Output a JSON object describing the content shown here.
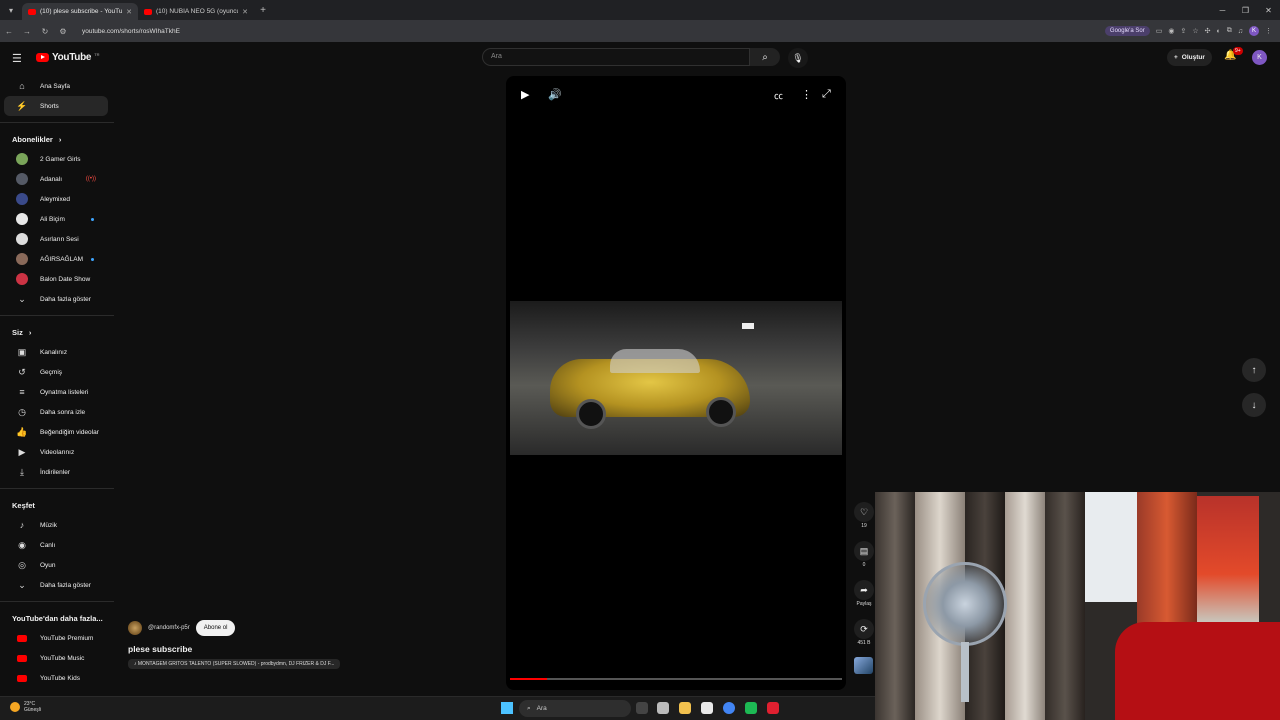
{
  "browser": {
    "tabs": [
      {
        "title": "(10) plese subscribe - YouTube",
        "active": true
      },
      {
        "title": "(10) NUBIA NEO 5G (oyuncu tel",
        "active": false
      }
    ],
    "url": "youtube.com/shorts/rosWIhaTkhE",
    "google_chip": "Google'a Sor",
    "profile_initial": "K"
  },
  "header": {
    "logo_text": "YouTube",
    "logo_region": "TR",
    "search_placeholder": "Ara",
    "create_label": "Oluştur",
    "notif_badge": "9+",
    "avatar_initial": "K"
  },
  "sidebar": {
    "main": [
      {
        "label": "Ana Sayfa",
        "icon": "home-icon",
        "glyph": "⌂"
      },
      {
        "label": "Shorts",
        "icon": "shorts-icon",
        "glyph": "⚡",
        "selected": true
      }
    ],
    "subs_heading": "Abonelikler",
    "subs": [
      {
        "label": "2 Gamer Girls",
        "color": "#7aa55a"
      },
      {
        "label": "Adanalı",
        "color": "#555a66",
        "badge": "live"
      },
      {
        "label": "Aleymixed",
        "color": "#3a4a8a"
      },
      {
        "label": "Ali Biçim",
        "color": "#e8e8e8",
        "badge": "dot"
      },
      {
        "label": "Asırların Sesi",
        "color": "#dddddd"
      },
      {
        "label": "AĞIRSAĞLAM",
        "color": "#8a6a5a",
        "badge": "dot"
      },
      {
        "label": "Balon Date Show",
        "color": "#cc3344"
      }
    ],
    "subs_more": "Daha fazla göster",
    "you_heading": "Siz",
    "you": [
      {
        "label": "Kanalınız",
        "icon": "channel-icon",
        "glyph": "▣"
      },
      {
        "label": "Geçmiş",
        "icon": "history-icon",
        "glyph": "↺"
      },
      {
        "label": "Oynatma listeleri",
        "icon": "playlist-icon",
        "glyph": "≡"
      },
      {
        "label": "Daha sonra izle",
        "icon": "clock-icon",
        "glyph": "◷"
      },
      {
        "label": "Beğendiğim videolar",
        "icon": "like-icon",
        "glyph": "👍"
      },
      {
        "label": "Videolarınız",
        "icon": "video-icon",
        "glyph": "▶"
      },
      {
        "label": "İndirilenler",
        "icon": "download-icon",
        "glyph": "⤓"
      }
    ],
    "explore_heading": "Keşfet",
    "explore": [
      {
        "label": "Müzik",
        "icon": "music-icon",
        "glyph": "♪"
      },
      {
        "label": "Canlı",
        "icon": "live-icon",
        "glyph": "◉"
      },
      {
        "label": "Oyun",
        "icon": "gaming-icon",
        "glyph": "◎"
      }
    ],
    "explore_more": "Daha fazla göster",
    "more_heading": "YouTube'dan daha fazla...",
    "more": [
      {
        "label": "YouTube Premium"
      },
      {
        "label": "YouTube Music"
      },
      {
        "label": "YouTube Kids"
      }
    ]
  },
  "short": {
    "channel": "@randomfx-p5r",
    "subscribe_label": "Abone ol",
    "title": "plese subscribe",
    "music": "♪ MONTAGEM GRITOS TALENTO (SUPER SLOWED) - prodbydmn, DJ FRIZER & DJ F...",
    "progress": 0.11
  },
  "actions": {
    "likes": "19",
    "comments": "0",
    "share": "Paylaş",
    "remix": "451 B"
  },
  "taskbar": {
    "temp": "23°C",
    "weather": "Güneşli",
    "search": "Ara"
  }
}
